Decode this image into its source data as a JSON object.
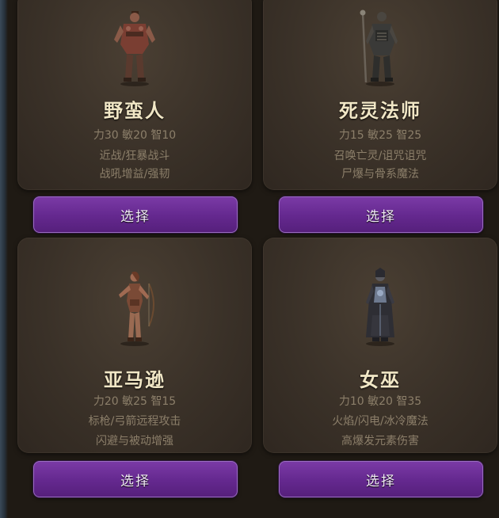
{
  "characters": [
    {
      "name": "野蛮人",
      "stats": "力30 敏20 智10",
      "skills": "近战/狂暴战斗",
      "traits": "战吼增益/强韧",
      "select_label": "选择",
      "icon": "barbarian-figure-icon"
    },
    {
      "name": "死灵法师",
      "stats": "力15 敏25 智25",
      "skills": "召唤亡灵/诅咒诅咒",
      "traits": "尸爆与骨系魔法",
      "select_label": "选择",
      "icon": "necromancer-figure-icon"
    },
    {
      "name": "亚马逊",
      "stats": "力20 敏25 智15",
      "skills": "标枪/弓箭远程攻击",
      "traits": "闪避与被动增强",
      "select_label": "选择",
      "icon": "amazon-figure-icon"
    },
    {
      "name": "女巫",
      "stats": "力10 敏20 智35",
      "skills": "火焰/闪电/冰冷魔法",
      "traits": "高爆发元素伤害",
      "select_label": "选择",
      "icon": "sorceress-figure-icon"
    }
  ],
  "colors": {
    "background": "#1f1a14",
    "card": "#3a3128",
    "name_text": "#f1e7c6",
    "detail_text": "#8c7f6a",
    "button": "#6b2d96",
    "button_text": "#f2ecf6"
  }
}
